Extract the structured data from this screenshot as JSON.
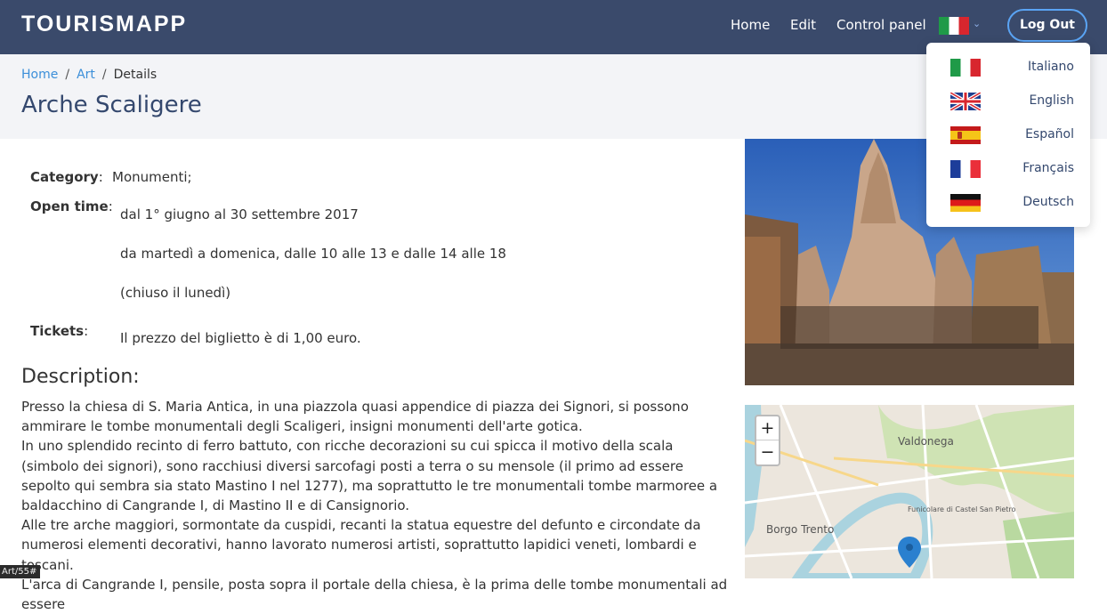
{
  "brand": "TOURISMAPP",
  "nav": {
    "home": "Home",
    "edit": "Edit",
    "control_panel": "Control panel",
    "logout": "Log Out"
  },
  "breadcrumb": {
    "home": "Home",
    "art": "Art",
    "current": "Details"
  },
  "page_title": "Arche Scaligere",
  "details": {
    "category_label": "Category",
    "category_value": "Monumenti;",
    "open_time_label": "Open time",
    "open_time_lines": [
      "dal 1° giugno al 30 settembre 2017",
      "da martedì a domenica, dalle 10 alle 13 e dalle 14 alle 18",
      "(chiuso il lunedì)"
    ],
    "tickets_label": "Tickets",
    "tickets_value": "Il prezzo del biglietto è di 1,00 euro."
  },
  "description": {
    "title": "Description:",
    "text": "Presso la chiesa di S. Maria Antica, in una piazzola quasi appendice di piazza dei Signori, si possono ammirare le tombe monumentali degli Scaligeri, insigni monumenti dell'arte gotica.\nIn uno splendido recinto di ferro battuto, con ricche decorazioni su cui spicca il motivo della scala (simbolo dei signori), sono racchiusi diversi sarcofagi posti a terra o su mensole (il primo ad essere sepolto qui sembra sia stato Mastino I nel 1277), ma soprattutto le tre monumentali tombe marmoree a baldacchino di Cangrande I, di Mastino II e di Cansignorio.\nAlle tre arche maggiori, sormontate da cuspidi, recanti la statua equestre del defunto e circondate da numerosi elementi decorativi, hanno lavorato numerosi artisti, soprattutto lapidici veneti, lombardi e toscani.\nL'arca di Cangrande I, pensile, posta sopra il portale della chiesa, è la prima delle tombe monumentali ad essere"
  },
  "map": {
    "zoom_in": "+",
    "zoom_out": "−",
    "labels": {
      "valdonega": "Valdonega",
      "borgo_trento": "Borgo Trento",
      "funicolare": "Funicolare di Castel San Pietro"
    }
  },
  "languages": [
    {
      "code": "it",
      "label": "Italiano"
    },
    {
      "code": "gb",
      "label": "English"
    },
    {
      "code": "es",
      "label": "Español"
    },
    {
      "code": "fr",
      "label": "Français"
    },
    {
      "code": "de",
      "label": "Deutsch"
    }
  ],
  "status_url": "Art/55#"
}
